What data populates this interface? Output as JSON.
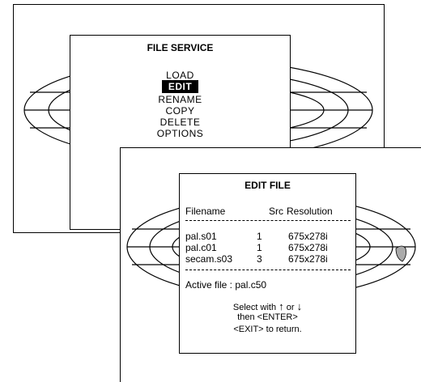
{
  "file_service": {
    "title": "FILE SERVICE",
    "items": [
      {
        "label": "LOAD",
        "selected": false
      },
      {
        "label": "EDIT",
        "selected": true
      },
      {
        "label": "RENAME",
        "selected": false
      },
      {
        "label": "COPY",
        "selected": false
      },
      {
        "label": "DELETE",
        "selected": false
      },
      {
        "label": "OPTIONS",
        "selected": false
      }
    ]
  },
  "edit_file": {
    "title": "EDIT FILE",
    "col_filename": "Filename",
    "col_src": "Src",
    "col_resolution": "Resolution",
    "rows": [
      {
        "filename": "pal.s01",
        "src": "1",
        "resolution": "675x278i"
      },
      {
        "filename": "pal.c01",
        "src": "1",
        "resolution": "675x278i"
      },
      {
        "filename": "secam.s03",
        "src": "3",
        "resolution": "675x278i"
      }
    ],
    "active_label": "Active file :",
    "active_value": "pal.c50",
    "help_select": "Select with",
    "help_or": "or",
    "help_then": "then <ENTER>",
    "help_exit": "<EXIT> to return."
  }
}
